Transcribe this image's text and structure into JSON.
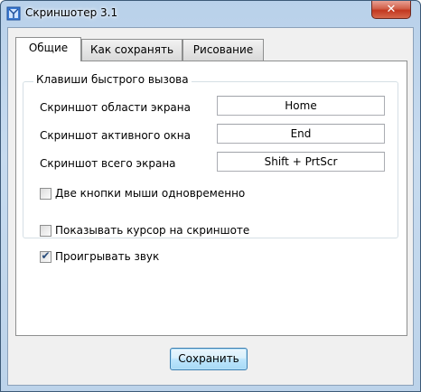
{
  "window": {
    "title": "Скриншотер 3.1",
    "close_label": "✕"
  },
  "tabs": [
    {
      "label": "Общие",
      "active": true
    },
    {
      "label": "Как сохранять",
      "active": false
    },
    {
      "label": "Рисование",
      "active": false
    }
  ],
  "hotkeys_group": {
    "title": "Клавиши быстрого вызова",
    "rows": [
      {
        "label": "Скриншот области экрана",
        "value": "Home"
      },
      {
        "label": "Скриншот активного окна",
        "value": "End"
      },
      {
        "label": "Скриншот всего экрана",
        "value": "Shift + PrtScr"
      }
    ],
    "two_mouse_buttons": {
      "label": "Две кнопки мыши одновременно",
      "checked": false
    }
  },
  "options": [
    {
      "label": "Показывать курсор на скриншоте",
      "checked": false
    },
    {
      "label": "Проигрывать звук",
      "checked": true
    }
  ],
  "check_mark": "✔",
  "save_label": "Сохранить"
}
